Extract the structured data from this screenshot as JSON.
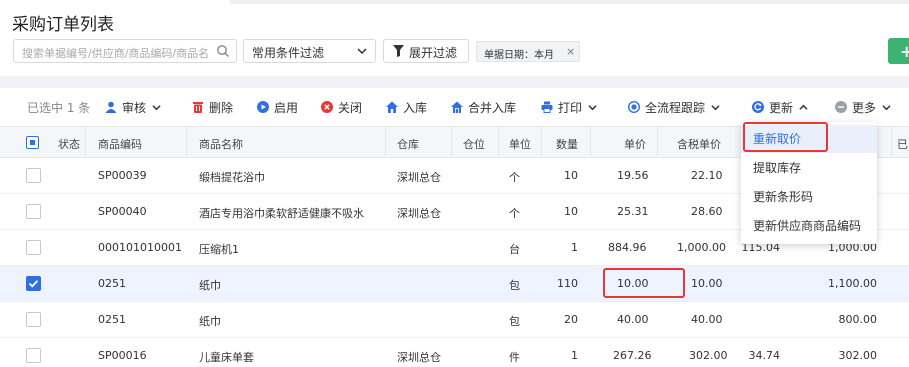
{
  "page": {
    "title": "采购订单列表"
  },
  "filters": {
    "search_placeholder": "搜索单据编号/供应商/商品编码/商品名",
    "condition_select": "常用条件过滤",
    "expand_label": "展开过滤",
    "date_tag": "单据日期：本月",
    "tag_close": "×"
  },
  "toolbar": {
    "selected": "已选中 1 条",
    "audit": "审核",
    "delete": "删除",
    "enable": "启用",
    "close": "关闭",
    "stock_in": "入库",
    "merge_in": "合并入库",
    "print": "打印",
    "track": "全流程跟踪",
    "update": "更新",
    "more": "更多"
  },
  "colors": {
    "primary": "#2f6fe4",
    "danger": "#e53935",
    "success": "#3cb371"
  },
  "table": {
    "headers": [
      "状态",
      "商品编码",
      "商品名称",
      "仓库",
      "仓位",
      "单位",
      "数量",
      "单价",
      "含税单价",
      "已"
    ],
    "rows": [
      {
        "checked": false,
        "code": "SP00039",
        "name": "缎档提花浴巾",
        "warehouse": "深圳总仓",
        "unit": "个",
        "qty": "10",
        "price": "19.56",
        "tax_price": "22.10",
        "tax": "",
        "amount": ""
      },
      {
        "checked": false,
        "code": "SP00040",
        "name": "酒店专用浴巾柔软舒适健康不吸水",
        "warehouse": "深圳总仓",
        "unit": "个",
        "qty": "10",
        "price": "25.31",
        "tax_price": "28.60",
        "tax": "",
        "amount": ""
      },
      {
        "checked": false,
        "code": "000101010001",
        "name": "压缩机1",
        "warehouse": "",
        "unit": "台",
        "qty": "1",
        "price": "884.96",
        "tax_price": "1,000.00",
        "tax": "115.04",
        "amount": "1,000.00"
      },
      {
        "checked": true,
        "code": "0251",
        "name": "纸巾",
        "warehouse": "",
        "unit": "包",
        "qty": "110",
        "price": "10.00",
        "tax_price": "10.00",
        "tax": "",
        "amount": "1,100.00"
      },
      {
        "checked": false,
        "code": "0251",
        "name": "纸巾",
        "warehouse": "",
        "unit": "包",
        "qty": "20",
        "price": "40.00",
        "tax_price": "40.00",
        "tax": "",
        "amount": "800.00"
      },
      {
        "checked": false,
        "code": "SP00016",
        "name": "儿童床单套",
        "warehouse": "深圳总仓",
        "unit": "件",
        "qty": "1",
        "price": "267.26",
        "tax_price": "302.00",
        "tax": "34.74",
        "amount": "302.00"
      }
    ]
  },
  "update_menu": {
    "items": [
      "重新取价",
      "提取库存",
      "更新条形码",
      "更新供应商商品编码"
    ],
    "active_index": 0
  }
}
